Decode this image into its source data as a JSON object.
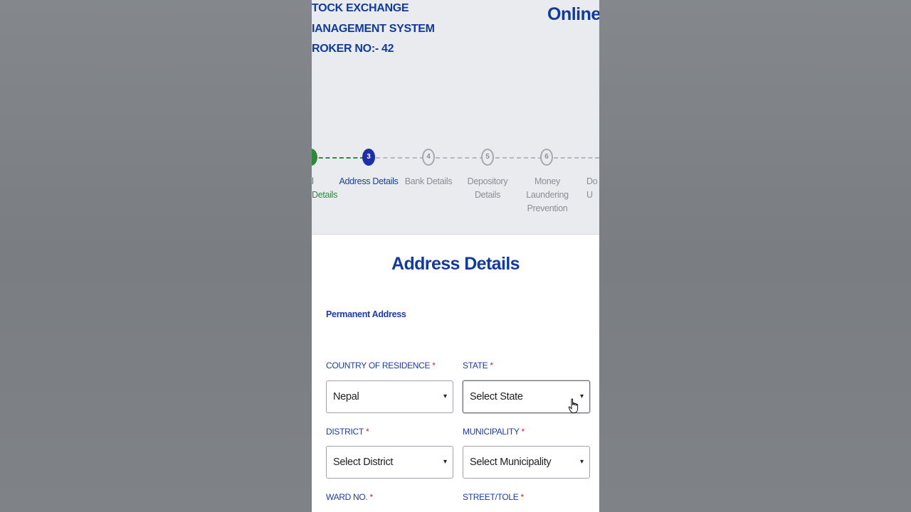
{
  "header": {
    "brand_line1": "TOCK EXCHANGE",
    "brand_line2": "IANAGEMENT SYSTEM",
    "brand_line3": "ROKER NO:- 42",
    "page_title": "Online Re"
  },
  "stepper": {
    "steps": [
      {
        "number": "",
        "label": "l Details",
        "state": "done"
      },
      {
        "number": "3",
        "label": "Address Details",
        "state": "active"
      },
      {
        "number": "4",
        "label": "Bank Details",
        "state": "upcoming"
      },
      {
        "number": "5",
        "label": "Depository Details",
        "state": "upcoming"
      },
      {
        "number": "6",
        "label": "Money Laundering Prevention",
        "state": "upcoming"
      },
      {
        "number": "",
        "label": "Do U",
        "state": "upcoming"
      }
    ]
  },
  "form": {
    "title": "Address Details",
    "subsection": "Permanent Address",
    "required_mark": "*",
    "fields": {
      "country": {
        "label": "COUNTRY OF RESIDENCE",
        "value": "Nepal"
      },
      "state": {
        "label": "STATE",
        "value": "Select State"
      },
      "district": {
        "label": "DISTRICT",
        "value": "Select District"
      },
      "municipality": {
        "label": "MUNICIPALITY",
        "value": "Select Municipality"
      },
      "ward": {
        "label": "WARD NO."
      },
      "street": {
        "label": "STREET/TOLE"
      }
    },
    "chevron_glyph": "▾"
  },
  "colors": {
    "brand_blue": "#123a9c",
    "active_step": "#1c2fa8",
    "done_step": "#2e8a3a",
    "required_red": "#d2232a"
  },
  "icons": {
    "cursor": "hand-pointer-icon",
    "dropdown": "chevron-down-icon"
  }
}
